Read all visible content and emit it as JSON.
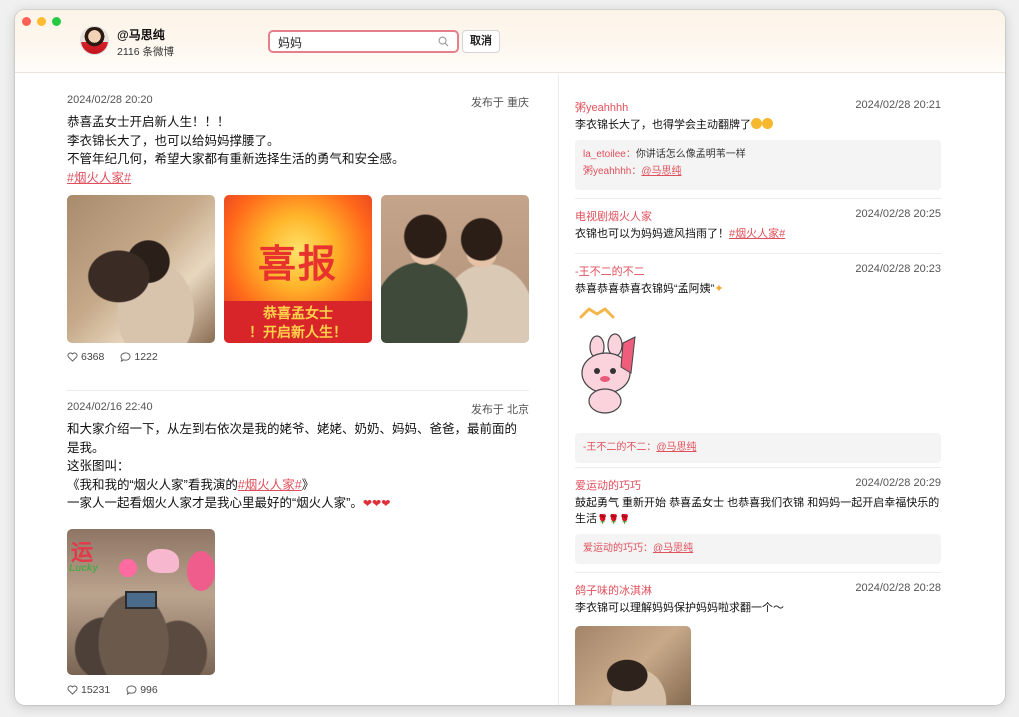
{
  "header": {
    "user_name": "@马思纯",
    "post_count": "2116 条微博",
    "search_value": "妈妈",
    "cancel_label": "取消"
  },
  "posts": [
    {
      "date": "2024/02/28 20:20",
      "location": "发布于 重庆",
      "lines": [
        "恭喜孟女士开启新人生！！！",
        "李衣锦长大了，也可以给妈妈撑腰了。",
        "不管年纪几何，希望大家都有重新选择生活的勇气和安全感。"
      ],
      "tag": "#烟火人家#",
      "poster_title": "喜报",
      "poster_line1": "恭喜孟女士",
      "poster_line2": "！开启新人生！",
      "likes": "6368",
      "comments": "1222"
    },
    {
      "date": "2024/02/16 22:40",
      "location": "发布于 北京",
      "lines": [
        "和大家介绍一下，从左到右依次是我的姥爷、姥姥、奶奶、妈妈、爸爸，最前面的是我。",
        "这张图叫：",
        "《我和我的“烟火人家”看我演的",
        "#烟火人家#",
        "》",
        "一家人一起看烟火人家才是我心里最好的“烟火人家”。"
      ],
      "sticker_text": "运",
      "sticker_lucky": "Lucky",
      "likes": "15231",
      "comments": "996"
    }
  ],
  "comments": [
    {
      "name": "粥yeahhhh",
      "time": "2024/02/28 20:21",
      "text": "李衣锦长大了，也得学会主动翻牌了",
      "reply_lines": [
        {
          "user": "la_etoilee：",
          "text": "你讲话怎么像孟明苇一样"
        },
        {
          "user": "粥yeahhhh：",
          "mention": "@马思纯"
        }
      ]
    },
    {
      "name": "电视剧烟火人家",
      "time": "2024/02/28 20:25",
      "text": "衣锦也可以为妈妈遮风挡雨了！",
      "tag": "#烟火人家#"
    },
    {
      "name": "-王不二的不二",
      "time": "2024/02/28 20:23",
      "text": "恭喜恭喜恭喜衣锦妈“孟阿姨”",
      "reply_lines": [
        {
          "user": "-王不二的不二：",
          "mention": "@马思纯"
        }
      ]
    },
    {
      "name": "爱运动的巧巧",
      "time": "2024/02/28 20:29",
      "text": "鼓起勇气 重新开始 恭喜孟女士 也恭喜我们衣锦 和妈妈一起开启幸福快乐的生活",
      "reply_lines": [
        {
          "user": "爱运动的巧巧：",
          "mention": "@马思纯"
        }
      ]
    },
    {
      "name": "鸽子味的冰淇淋",
      "time": "2024/02/28 20:28",
      "text": "李衣锦可以理解妈妈保护妈妈啦求翻一个～"
    }
  ],
  "colors": {
    "accent": "#e0505c",
    "search_border": "#e5808a",
    "poster_red": "#d8252a",
    "poster_yellow": "#ffd24a"
  },
  "icons": [
    "search-icon",
    "heart-icon",
    "comment-icon",
    "like-icon"
  ]
}
